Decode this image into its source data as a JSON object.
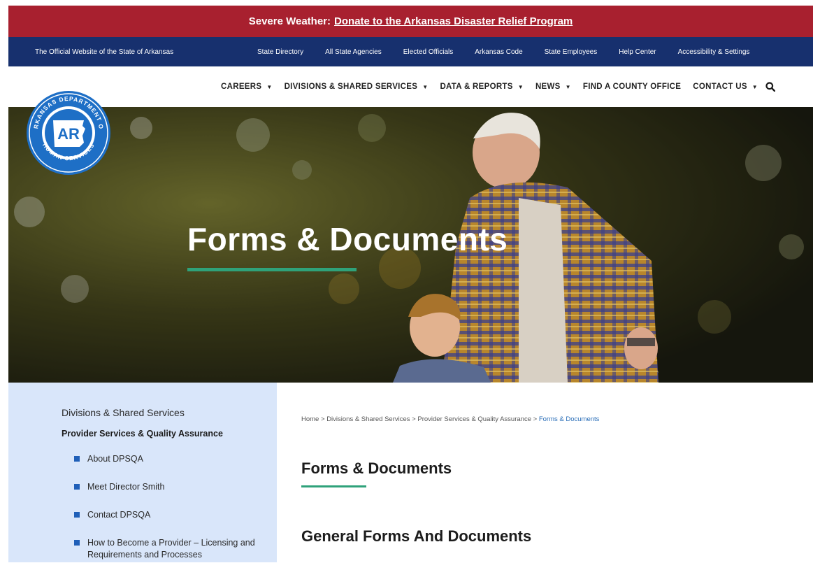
{
  "alert": {
    "prefix": "Severe Weather:",
    "link_text": "Donate to the Arkansas Disaster Relief Program"
  },
  "state_bar": {
    "official_text": "The Official Website of the State of Arkansas",
    "links": [
      "State Directory",
      "All State Agencies",
      "Elected Officials",
      "Arkansas Code",
      "State Employees",
      "Help Center",
      "Accessibility & Settings"
    ]
  },
  "logo": {
    "text_top": "ARKANSAS DEPARTMENT OF",
    "text_bottom": "HUMAN SERVICES",
    "monogram": "AR",
    "colors": {
      "ring": "#1e6fc6",
      "badge": "#ffffff"
    }
  },
  "nav": {
    "items": [
      "CAREERS",
      "DIVISIONS & SHARED SERVICES",
      "DATA & REPORTS",
      "NEWS",
      "FIND A COUNTY OFFICE",
      "CONTACT US"
    ],
    "search_icon": "search-icon"
  },
  "hero": {
    "title": "Forms & Documents"
  },
  "sidebar": {
    "parent": "Divisions & Shared Services",
    "current": "Provider Services & Quality Assurance",
    "items": [
      "About DPSQA",
      "Meet Director Smith",
      "Contact DPSQA",
      "How to Become a Provider – Licensing and Requirements and Processes"
    ]
  },
  "breadcrumb": {
    "items": [
      "Home",
      "Divisions & Shared Services",
      "Provider Services & Quality Assurance"
    ],
    "current": "Forms & Documents",
    "separator": ">"
  },
  "content": {
    "title": "Forms & Documents",
    "section_title": "General Forms And Documents"
  },
  "colors": {
    "alert_bg": "#a8202f",
    "state_bar_bg": "#17306e",
    "accent_green": "#2fa27a",
    "sidebar_bg": "#d9e6fa",
    "bullet_blue": "#1f5fb8"
  }
}
